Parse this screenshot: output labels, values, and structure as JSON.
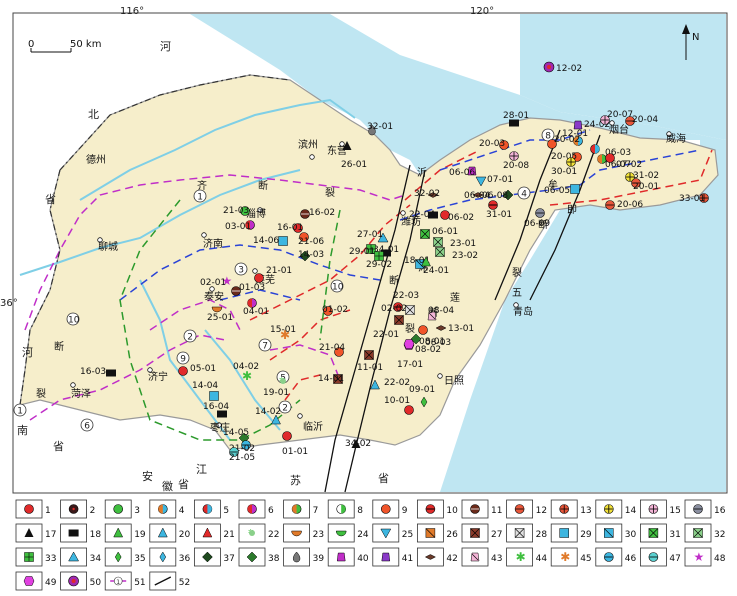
{
  "coords": {
    "lon_116": "116°",
    "lon_120": "120°",
    "lat_36": "36°"
  },
  "scale": {
    "zero": "0",
    "distance": "50 km"
  },
  "north": "N",
  "places": [
    {
      "id": "dezhou",
      "text": "德州"
    },
    {
      "id": "binzhou",
      "text": "滨州"
    },
    {
      "id": "dongying",
      "text": "东营"
    },
    {
      "id": "yantai",
      "text": "烟台"
    },
    {
      "id": "weihai",
      "text": "威海"
    },
    {
      "id": "weifang",
      "text": "潍坊"
    },
    {
      "id": "zibo",
      "text": "淄博"
    },
    {
      "id": "jinan",
      "text": "济南"
    },
    {
      "id": "liaocheng",
      "text": "聊城"
    },
    {
      "id": "taian",
      "text": "泰安"
    },
    {
      "id": "laiwu",
      "text": "莱芜"
    },
    {
      "id": "jining",
      "text": "济宁"
    },
    {
      "id": "heze",
      "text": "菏泽"
    },
    {
      "id": "zaozhuang",
      "text": "枣庄"
    },
    {
      "id": "linyi",
      "text": "临沂"
    },
    {
      "id": "rizhao",
      "text": "日照"
    },
    {
      "id": "qingdao",
      "text": "青岛"
    }
  ],
  "regions": [
    {
      "id": "he1",
      "text": "河"
    },
    {
      "id": "bei",
      "text": "北"
    },
    {
      "id": "sheng1",
      "text": "省"
    },
    {
      "id": "he2",
      "text": "河"
    },
    {
      "id": "nan",
      "text": "南"
    },
    {
      "id": "sheng2",
      "text": "省"
    },
    {
      "id": "jiang",
      "text": "江"
    },
    {
      "id": "su",
      "text": "苏"
    },
    {
      "id": "sheng3",
      "text": "省"
    },
    {
      "id": "an",
      "text": "安"
    },
    {
      "id": "hui",
      "text": "徽"
    },
    {
      "id": "sheng4",
      "text": "省"
    }
  ],
  "fault_labels": [
    {
      "id": "qi",
      "text": "齐"
    },
    {
      "id": "duan1",
      "text": "断"
    },
    {
      "id": "lie1",
      "text": "裂"
    },
    {
      "id": "yi",
      "text": "沂"
    },
    {
      "id": "shu",
      "text": "沭"
    },
    {
      "id": "duan2",
      "text": "断"
    },
    {
      "id": "lie2",
      "text": "裂"
    },
    {
      "id": "mou",
      "text": "牟"
    },
    {
      "id": "ji",
      "text": "即"
    },
    {
      "id": "duan3",
      "text": "断"
    },
    {
      "id": "lie3",
      "text": "裂"
    },
    {
      "id": "wu",
      "text": "五"
    },
    {
      "id": "lian",
      "text": "莲"
    },
    {
      "id": "duan4",
      "text": "断"
    },
    {
      "id": "duan5",
      "text": "断"
    },
    {
      "id": "lie4",
      "text": "裂"
    }
  ],
  "circled": [
    {
      "id": "c1a",
      "text": "1"
    },
    {
      "id": "c1b",
      "text": "1"
    },
    {
      "id": "c2a",
      "text": "2"
    },
    {
      "id": "c2b",
      "text": "2"
    },
    {
      "id": "c3",
      "text": "3"
    },
    {
      "id": "c4",
      "text": "4"
    },
    {
      "id": "c5",
      "text": "5"
    },
    {
      "id": "c6",
      "text": "6"
    },
    {
      "id": "c7",
      "text": "7"
    },
    {
      "id": "c8",
      "text": "8"
    },
    {
      "id": "c9",
      "text": "9"
    },
    {
      "id": "c10a",
      "text": "10"
    },
    {
      "id": "c10b",
      "text": "10"
    }
  ],
  "sites": [
    {
      "code": "12-02",
      "legend": 50
    },
    {
      "code": "28-01",
      "legend": 18
    },
    {
      "code": "24-02",
      "legend": 41
    },
    {
      "code": "20-07",
      "legend": 15
    },
    {
      "code": "20-04",
      "legend": 12
    },
    {
      "code": "12-01",
      "legend": 4
    },
    {
      "code": "20-03",
      "legend": 9
    },
    {
      "code": "20-02",
      "legend": 9
    },
    {
      "code": "20-08",
      "legend": 15
    },
    {
      "code": "20-05",
      "legend": 9
    },
    {
      "code": "06-03",
      "legend": 5
    },
    {
      "code": "06-07",
      "legend": 7
    },
    {
      "code": "30-01",
      "legend": 14
    },
    {
      "code": "07-02",
      "legend": 1
    },
    {
      "code": "31-02",
      "legend": 14
    },
    {
      "code": "20-01",
      "legend": 12
    },
    {
      "code": "20-06",
      "legend": 12
    },
    {
      "code": "33-01",
      "legend": 13
    },
    {
      "code": "32-01",
      "legend": 39
    },
    {
      "code": "26-01",
      "legend": 17
    },
    {
      "code": "06-06",
      "legend": 40
    },
    {
      "code": "07-01",
      "legend": 25
    },
    {
      "code": "32-02",
      "legend": 42
    },
    {
      "code": "06-04",
      "legend": 42
    },
    {
      "code": "06-08",
      "legend": 37
    },
    {
      "code": "06-05",
      "legend": 29
    },
    {
      "code": "31-01",
      "legend": 10
    },
    {
      "code": "06-09",
      "legend": 16
    },
    {
      "code": "22-04",
      "legend": 18
    },
    {
      "code": "06-02",
      "legend": 1
    },
    {
      "code": "06-01",
      "legend": 31
    },
    {
      "code": "23-01",
      "legend": 32
    },
    {
      "code": "23-02",
      "legend": 32
    },
    {
      "code": "27-01",
      "legend": 34
    },
    {
      "code": "34-01",
      "legend": 18
    },
    {
      "code": "29-01",
      "legend": 33
    },
    {
      "code": "29-02",
      "legend": 33
    },
    {
      "code": "18-01",
      "legend": 30
    },
    {
      "code": "24-01",
      "legend": 19
    },
    {
      "code": "21-03",
      "legend": 3
    },
    {
      "code": "16-02",
      "legend": 11
    },
    {
      "code": "03-01",
      "legend": 6
    },
    {
      "code": "16-01",
      "legend": 1
    },
    {
      "code": "21-06",
      "legend": 9
    },
    {
      "code": "14-06",
      "legend": 29
    },
    {
      "code": "14-03",
      "legend": 37
    },
    {
      "code": "21-01",
      "legend": 1
    },
    {
      "code": "02-01",
      "legend": 48
    },
    {
      "code": "01-03",
      "legend": 11
    },
    {
      "code": "04-01",
      "legend": 6
    },
    {
      "code": "25-01",
      "legend": 23
    },
    {
      "code": "01-02",
      "legend": 9
    },
    {
      "code": "02-02",
      "legend": 10
    },
    {
      "code": "22-03",
      "legend": 28
    },
    {
      "code": "08-04",
      "legend": 43
    },
    {
      "code": "08-01",
      "legend": 9
    },
    {
      "code": "13-01",
      "legend": 42
    },
    {
      "code": "22-01",
      "legend": 27
    },
    {
      "code": "08-03",
      "legend": 38
    },
    {
      "code": "08-02",
      "legend": 49
    },
    {
      "code": "17-01",
      "legend": 49
    },
    {
      "code": "15-01",
      "legend": 45
    },
    {
      "code": "21-04",
      "legend": 9
    },
    {
      "code": "11-01",
      "legend": 27
    },
    {
      "code": "22-02",
      "legend": 20
    },
    {
      "code": "09-01",
      "legend": 35
    },
    {
      "code": "10-01",
      "legend": 1
    },
    {
      "code": "05-01",
      "legend": 1
    },
    {
      "code": "16-03",
      "legend": 18
    },
    {
      "code": "14-04",
      "legend": 29
    },
    {
      "code": "04-02",
      "legend": 44
    },
    {
      "code": "19-01",
      "legend": 22
    },
    {
      "code": "14-01",
      "legend": 27
    },
    {
      "code": "16-04",
      "legend": 18
    },
    {
      "code": "14-02",
      "legend": 20
    },
    {
      "code": "14-05",
      "legend": 38
    },
    {
      "code": "21-02",
      "legend": 46
    },
    {
      "code": "21-05",
      "legend": 47
    },
    {
      "code": "01-01",
      "legend": 1
    },
    {
      "code": "34-02",
      "legend": 17
    }
  ],
  "legend": [
    {
      "n": "1"
    },
    {
      "n": "2"
    },
    {
      "n": "3"
    },
    {
      "n": "4"
    },
    {
      "n": "5"
    },
    {
      "n": "6"
    },
    {
      "n": "7"
    },
    {
      "n": "8"
    },
    {
      "n": "9"
    },
    {
      "n": "10"
    },
    {
      "n": "11"
    },
    {
      "n": "12"
    },
    {
      "n": "13"
    },
    {
      "n": "14"
    },
    {
      "n": "15"
    },
    {
      "n": "16"
    },
    {
      "n": "17"
    },
    {
      "n": "18"
    },
    {
      "n": "19"
    },
    {
      "n": "20"
    },
    {
      "n": "21"
    },
    {
      "n": "22"
    },
    {
      "n": "23"
    },
    {
      "n": "24"
    },
    {
      "n": "25"
    },
    {
      "n": "26"
    },
    {
      "n": "27"
    },
    {
      "n": "28"
    },
    {
      "n": "29"
    },
    {
      "n": "30"
    },
    {
      "n": "31"
    },
    {
      "n": "32"
    },
    {
      "n": "33"
    },
    {
      "n": "34"
    },
    {
      "n": "35"
    },
    {
      "n": "36"
    },
    {
      "n": "37"
    },
    {
      "n": "38"
    },
    {
      "n": "39"
    },
    {
      "n": "40"
    },
    {
      "n": "41"
    },
    {
      "n": "42"
    },
    {
      "n": "43"
    },
    {
      "n": "44"
    },
    {
      "n": "45"
    },
    {
      "n": "46"
    },
    {
      "n": "47"
    },
    {
      "n": "48"
    },
    {
      "n": "49"
    },
    {
      "n": "50"
    },
    {
      "n": "51"
    },
    {
      "n": "52"
    }
  ],
  "colors": {
    "land": "#f6eecb",
    "sea": "#bfe6f2",
    "river": "#7fcfe6",
    "boundary": "#9a9a9a",
    "red": "#e02a2a",
    "purple": "#c02ec8",
    "blue": "#2a43d6",
    "green": "#2c9a2c",
    "fault": "#111111"
  }
}
